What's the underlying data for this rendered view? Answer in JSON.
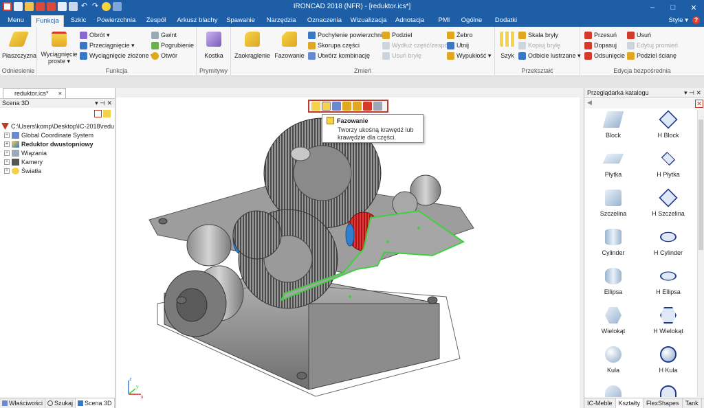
{
  "titlebar": {
    "title": "IRONCAD 2018 (NFR) - [reduktor.ics*]",
    "minimize": "–",
    "maximize": "□",
    "close": "✕"
  },
  "tabs": [
    {
      "label": "Menu",
      "active": false
    },
    {
      "label": "Funkcja",
      "active": true
    },
    {
      "label": "Szkic",
      "active": false
    },
    {
      "label": "Powierzchnia",
      "active": false
    },
    {
      "label": "Zespół",
      "active": false
    },
    {
      "label": "Arkusz blachy",
      "active": false
    },
    {
      "label": "Spawanie",
      "active": false
    },
    {
      "label": "Narzędzia",
      "active": false
    },
    {
      "label": "Oznaczenia",
      "active": false
    },
    {
      "label": "Wizualizacja",
      "active": false
    },
    {
      "label": "Adnotacja",
      "active": false
    },
    {
      "label": "PMI",
      "active": false
    },
    {
      "label": "Ogólne",
      "active": false
    },
    {
      "label": "Dodatki",
      "active": false
    }
  ],
  "tabrow_right": {
    "style": "Style ▾",
    "help": "?"
  },
  "ribbon": {
    "odniesienie": {
      "label": "Odniesienie",
      "plaszczyzna": "Płaszczyzna"
    },
    "funkcja": {
      "label": "Funkcja",
      "wyciagniecie_line1": "Wyciągnięcie",
      "wyciagniecie_line2": "proste ▾",
      "obrot": "Obrót ▾",
      "przeciagniecie": "Przeciągnięcie ▾",
      "wyciagniecie_zlozone": "Wyciągnięcie złożone ▾",
      "gwint": "Gwint",
      "pogrubienie": "Pogrubienie",
      "otwor": "Otwór"
    },
    "prymitywy": {
      "label": "Prymitywy",
      "kostka": "Kostka"
    },
    "zmien": {
      "label": "Zmień",
      "zaokraglenie": "Zaokrąglenie",
      "fazowanie": "Fazowanie",
      "pochylenie": "Pochylenie powierzchni",
      "skorupa": "Skorupa części",
      "kombinacja": "Utwórz kombinację",
      "podziel": "Podziel",
      "wydluz": "Wydłuż część/zespół",
      "usun_bryle": "Usuń bryłę",
      "zebro": "Żebro",
      "utnij": "Utnij",
      "wypuklosc": "Wypukłość ▾"
    },
    "przeksztalc": {
      "label": "Przekształć",
      "szyk": "Szyk",
      "skala": "Skala bryły",
      "kopiuj": "Kopiuj bryłę",
      "odbicie": "Odbicie lustrzane ▾"
    },
    "edycja": {
      "label": "Edycja bezpośrednia",
      "przesun": "Przesuń",
      "dopasuj": "Dopasuj",
      "odsuniecie": "Odsunięcie",
      "usun": "Usuń",
      "edytuj_promien": "Edytuj promień",
      "podziel_sciane": "Podziel ścianę"
    }
  },
  "document_tab": {
    "label": "reduktor.ics*",
    "close": "×"
  },
  "scene": {
    "title": "Scena 3D",
    "header_controls": "▾ ⊣ ✕",
    "tree": [
      {
        "label": "C:\\Users\\komp\\Desktop\\IC-2018\\redu",
        "bold": false
      },
      {
        "label": "Global Coordinate System",
        "bold": false
      },
      {
        "label": "Reduktor dwustopniowy",
        "bold": true
      },
      {
        "label": "Wiązania",
        "bold": false
      },
      {
        "label": "Kamery",
        "bold": false
      },
      {
        "label": "Światła",
        "bold": false
      }
    ]
  },
  "left_bottom_tabs": [
    "Właściwości",
    "Szukaj",
    "Scena 3D"
  ],
  "tooltip": {
    "title": "Fazowanie",
    "body_line1": "Tworzy ukośną krawędź lub",
    "body_line2": "krawędzie dla części."
  },
  "catalog": {
    "title": "Przeglądarka katalogu",
    "header_controls": "▾ ⊣ ✕",
    "items": [
      "Block",
      "H Block",
      "Płytka",
      "H Płytka",
      "Szczelina",
      "H Szczelina",
      "Cylinder",
      "H Cylinder",
      "Ellipsa",
      "H Ellipsa",
      "Wielokąt",
      "H Wielokąt",
      "Kula",
      "H Kula",
      "",
      ""
    ]
  },
  "right_bottom_tabs": [
    "IC-Meble",
    "Kształty",
    "FlexShapes",
    "Tank"
  ],
  "axis": {
    "x": "x",
    "y": "y",
    "z": "z"
  },
  "colors": {
    "accent": "#1d5ea6",
    "highlight_red": "#c0392b",
    "selection_green": "#3fcf3f",
    "gear_red": "#d32121",
    "bearing_blue": "#2f7fd0"
  }
}
